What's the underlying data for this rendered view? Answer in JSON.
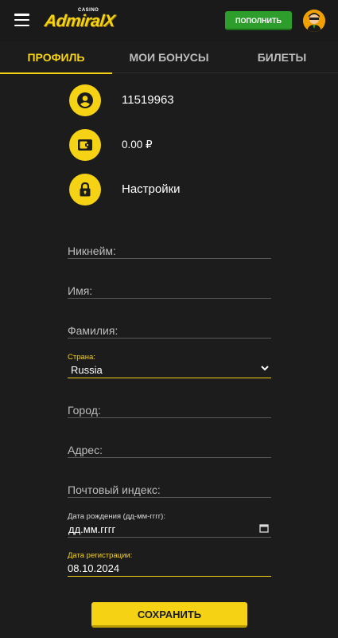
{
  "header": {
    "logo_small": "CASINO",
    "logo_big": "AdmiralX",
    "deposit_label": "ПОПОЛНИТЬ"
  },
  "tabs": [
    {
      "label": "ПРОФИЛЬ",
      "active": true
    },
    {
      "label": "МОИ БОНУСЫ",
      "active": false
    },
    {
      "label": "БИЛЕТЫ",
      "active": false
    }
  ],
  "profile": {
    "account_id": "11519963",
    "balance": "0.00 ₽",
    "settings_label": "Настройки"
  },
  "form": {
    "nickname_placeholder": "Никнейм:",
    "first_name_placeholder": "Имя:",
    "last_name_placeholder": "Фамилия:",
    "country_label": "Страна:",
    "country_value": "Russia",
    "city_placeholder": "Город:",
    "address_placeholder": "Адрес:",
    "zip_placeholder": "Почтовый индекс:",
    "birthdate_label": "Дата рождения (дд-мм-гггг):",
    "birthdate_value": "дд.мм.гггг",
    "registration_label": "Дата регистрации:",
    "registration_value": "08.10.2024",
    "save_label": "СОХРАНИТЬ"
  },
  "colors": {
    "accent": "#f5d314",
    "background": "#1c1c1c",
    "deposit": "#2d9e2b"
  }
}
